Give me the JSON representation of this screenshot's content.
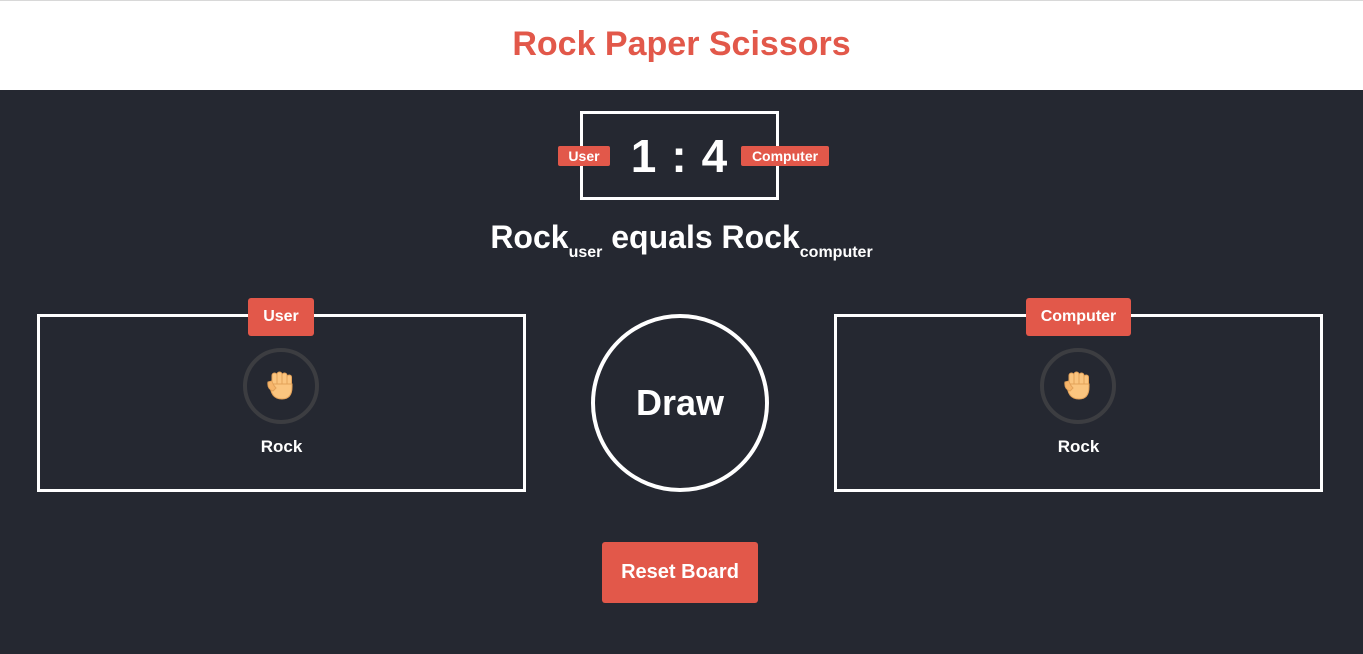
{
  "header": {
    "title": "Rock Paper Scissors"
  },
  "scoreboard": {
    "user_score": "1",
    "separator": ":",
    "computer_score": "4",
    "user_badge": "User",
    "computer_badge": "Computer"
  },
  "result_message": {
    "user_choice": "Rock",
    "user_sub": "user",
    "verb": "equals",
    "computer_choice": "Rock",
    "computer_sub": "computer"
  },
  "user_panel": {
    "badge": "User",
    "choice_icon": "raised-fist-icon",
    "choice_label": "Rock"
  },
  "computer_panel": {
    "badge": "Computer",
    "choice_icon": "raised-fist-icon",
    "choice_label": "Rock"
  },
  "result": {
    "label": "Draw"
  },
  "controls": {
    "reset_label": "Reset Board"
  },
  "colors": {
    "accent": "#e2584a",
    "background": "#252831",
    "header_background": "#ffffff",
    "text": "#ffffff",
    "icon_ring": "#3c3d41",
    "hand_skin": "#fbc57f"
  }
}
